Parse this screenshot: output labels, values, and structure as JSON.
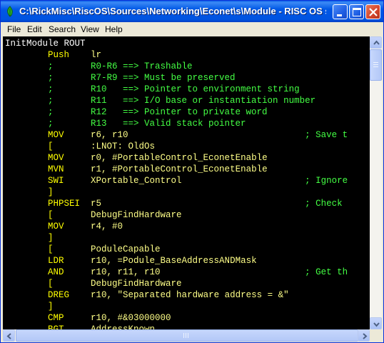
{
  "window": {
    "title": "C:\\RickMisc\\RiscOS\\Sources\\Networking\\Econet\\s\\Module - RISC OS s...",
    "controls": [
      "minimize",
      "maximize",
      "close"
    ]
  },
  "menu": [
    "File",
    "Edit",
    "Search",
    "View",
    "Help"
  ],
  "code_lines": [
    [
      [
        "InitModule ROUT",
        "label"
      ]
    ],
    [
      [
        "        Push    ",
        "mnem"
      ],
      [
        "lr",
        "op"
      ]
    ],
    [
      [
        "        ;       R0-R6 ==> Trashable",
        "com"
      ]
    ],
    [
      [
        "        ;       R7-R9 ==> Must be preserved",
        "com"
      ]
    ],
    [
      [
        "        ;       R10   ==> Pointer to environment string",
        "com"
      ]
    ],
    [
      [
        "        ;       R11   ==> I/O base or instantiation number",
        "com"
      ]
    ],
    [
      [
        "        ;       R12   ==> Pointer to private word",
        "com"
      ]
    ],
    [
      [
        "        ;       R13   ==> Valid stack pointer",
        "com"
      ]
    ],
    [
      [
        "        MOV     ",
        "mnem"
      ],
      [
        "r6, r10                                 ",
        "op"
      ],
      [
        "; Save t",
        "com"
      ]
    ],
    [
      [
        "        [       ",
        "mnem"
      ],
      [
        ":LNOT: OldOs",
        "op"
      ]
    ],
    [
      [
        "        MOV     ",
        "mnem"
      ],
      [
        "r0, #PortableControl_EconetEnable",
        "op"
      ]
    ],
    [
      [
        "        MVN     ",
        "mnem"
      ],
      [
        "r1, #PortableControl_EconetEnable",
        "op"
      ]
    ],
    [
      [
        "        SWI     ",
        "mnem"
      ],
      [
        "XPortable_Control                       ",
        "op"
      ],
      [
        "; Ignore",
        "com"
      ]
    ],
    [
      [
        "        ]",
        "mnem"
      ]
    ],
    [
      [
        "        PHPSEI  ",
        "mnem"
      ],
      [
        "r5                                      ",
        "op"
      ],
      [
        "; Check ",
        "com"
      ]
    ],
    [
      [
        "        [       ",
        "mnem"
      ],
      [
        "DebugFindHardware",
        "op"
      ]
    ],
    [
      [
        "        MOV     ",
        "mnem"
      ],
      [
        "r4, #0",
        "op"
      ]
    ],
    [
      [
        "        ]",
        "mnem"
      ]
    ],
    [
      [
        "        [       ",
        "mnem"
      ],
      [
        "PoduleCapable",
        "op"
      ]
    ],
    [
      [
        "        LDR     ",
        "mnem"
      ],
      [
        "r10, =Podule_BaseAddressANDMask",
        "op"
      ]
    ],
    [
      [
        "        AND     ",
        "mnem"
      ],
      [
        "r10, r11, r10                           ",
        "op"
      ],
      [
        "; Get th",
        "com"
      ]
    ],
    [
      [
        "        [       ",
        "mnem"
      ],
      [
        "DebugFindHardware",
        "op"
      ]
    ],
    [
      [
        "        DREG    ",
        "mnem"
      ],
      [
        "r10, ",
        "op"
      ],
      [
        "\"Separated hardware address = &\"",
        "str"
      ]
    ],
    [
      [
        "        ]",
        "mnem"
      ]
    ],
    [
      [
        "        CMP     ",
        "mnem"
      ],
      [
        "r10, #&03000000",
        "op"
      ]
    ],
    [
      [
        "        BGT     ",
        "mnem"
      ],
      [
        "AddressKnown",
        "op"
      ]
    ]
  ]
}
